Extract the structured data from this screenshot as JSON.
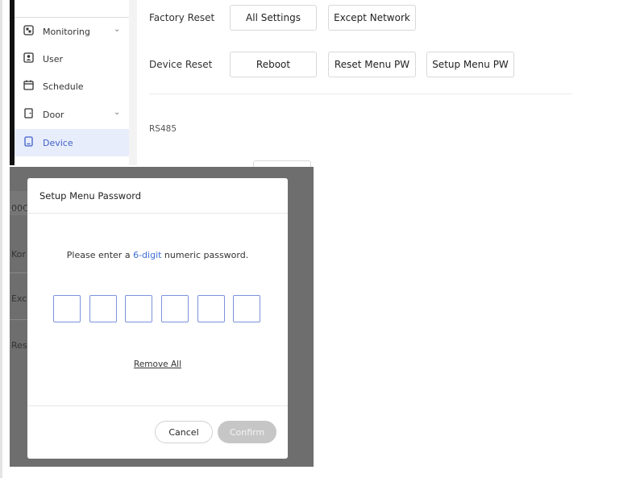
{
  "sidebar": {
    "items": [
      {
        "label": "Monitoring",
        "icon": "monitoring-icon",
        "expandable": true,
        "active": false
      },
      {
        "label": "User",
        "icon": "user-icon",
        "expandable": false,
        "active": false
      },
      {
        "label": "Schedule",
        "icon": "calendar-icon",
        "expandable": false,
        "active": false
      },
      {
        "label": "Door",
        "icon": "door-icon",
        "expandable": true,
        "active": false
      },
      {
        "label": "Device",
        "icon": "device-icon",
        "expandable": false,
        "active": true
      }
    ]
  },
  "main": {
    "factory_reset": {
      "label": "Factory Reset",
      "buttons": [
        "All Settings",
        "Except Network"
      ]
    },
    "device_reset": {
      "label": "Device Reset",
      "buttons": [
        "Reboot",
        "Reset Menu PW",
        "Setup Menu PW"
      ]
    },
    "rs485_label": "RS485"
  },
  "background_fragments": [
    "00C",
    "Kor",
    "Exc",
    "Res"
  ],
  "modal": {
    "title": "Setup Menu Password",
    "prompt_prefix": "Please enter a ",
    "prompt_highlight": "6-digit",
    "prompt_suffix": " numeric password.",
    "pin_count": 6,
    "remove_all": "Remove All",
    "cancel": "Cancel",
    "confirm": "Confirm"
  },
  "colors": {
    "accent": "#3f6fd6",
    "active_bg": "#e8edfb",
    "overlay": "#6e6e6e",
    "disabled": "#c6c6c6"
  }
}
